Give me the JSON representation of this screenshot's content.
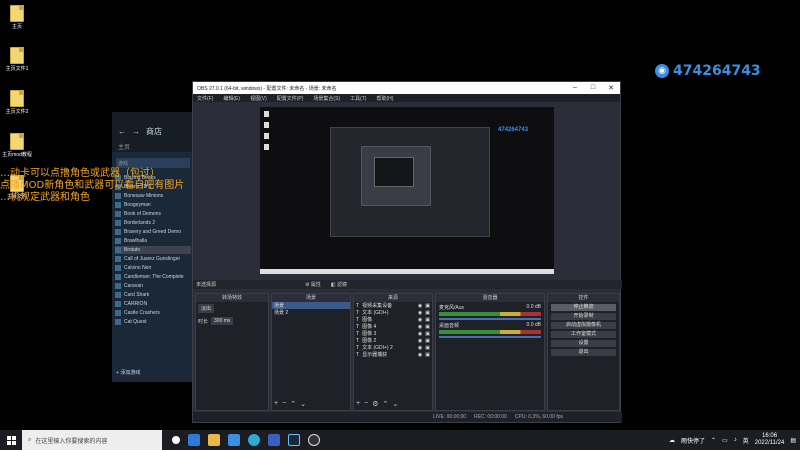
{
  "desktop": {
    "icons": [
      {
        "label": "主页"
      },
      {
        "label": "主页文件1"
      },
      {
        "label": "主页文件2"
      },
      {
        "label": "主页mod教程"
      },
      {
        "label": "主页文件"
      }
    ],
    "watermark": "474264743"
  },
  "overlay_lines": [
    "…动卡可以点撸角色或武器（包过）",
    "点播MOD新角色和武器可以看自吧有图片",
    "…机规定武器和角色"
  ],
  "steam": {
    "nav_label": "商店",
    "home_label": "主页",
    "search_placeholder": "游戏",
    "games": [
      "Blazing Beaks",
      "Bloons TD 6",
      "Bonesaw Minions",
      "Boogeyman",
      "Book of Demons",
      "Borderlands 2",
      "Bravery and Greed Demo",
      "Brawlhalla",
      "Brotato",
      "Call of Juarez Gunslinger",
      "Calvino Noir",
      "Candleman: The Complete",
      "Caravan",
      "Card Shark",
      "CARRION",
      "Castle Crashers",
      "Cat Quest"
    ],
    "selected_index": 8,
    "add_game_label": "添加游戏"
  },
  "obs": {
    "title": "OBS 27.0.1 (64-bit, windows) - 配置文件: 未命名 - 场景: 未命名",
    "menu": [
      "文件(F)",
      "编辑(E)",
      "视图(V)",
      "配置文件(P)",
      "场景集合(S)",
      "工具(T)",
      "帮助(H)"
    ],
    "selection_label": "未选择源",
    "props_label": "属性",
    "filters_label": "滤镜",
    "docks": {
      "transitions": {
        "title": "转场特效",
        "mode": "淡出",
        "duration_label": "时长",
        "duration_value": "300 ms"
      },
      "scenes": {
        "title": "场景",
        "items": [
          "场景",
          "场景 2"
        ]
      },
      "sources": {
        "title": "来源",
        "items": [
          "视频采集设备",
          "文本 (GDI+)",
          "图像",
          "图像 4",
          "图像 3",
          "图像 2",
          "文本 (GDI+) 2",
          "显示器捕获"
        ]
      },
      "mixer": {
        "title": "混音器",
        "channels": [
          {
            "name": "麦克风/Aux",
            "db": "0.0 dB"
          },
          {
            "name": "桌面音频",
            "db": "0.0 dB"
          }
        ]
      },
      "controls": {
        "title": "控件",
        "buttons": [
          "停止推流",
          "开始录制",
          "启动虚拟摄像机",
          "工作室模式",
          "设置",
          "退出"
        ]
      }
    },
    "status": {
      "live": "LIVE: 00:00:00",
      "rec": "REC: 00:00:00",
      "cpu": "CPU: 0.3%, 60.00 fps"
    }
  },
  "taskbar": {
    "search_placeholder": "在这里输入你要搜索的内容",
    "weather": "雨快停了",
    "lang": "英",
    "time": "16:06",
    "date": "2022/11/24"
  }
}
